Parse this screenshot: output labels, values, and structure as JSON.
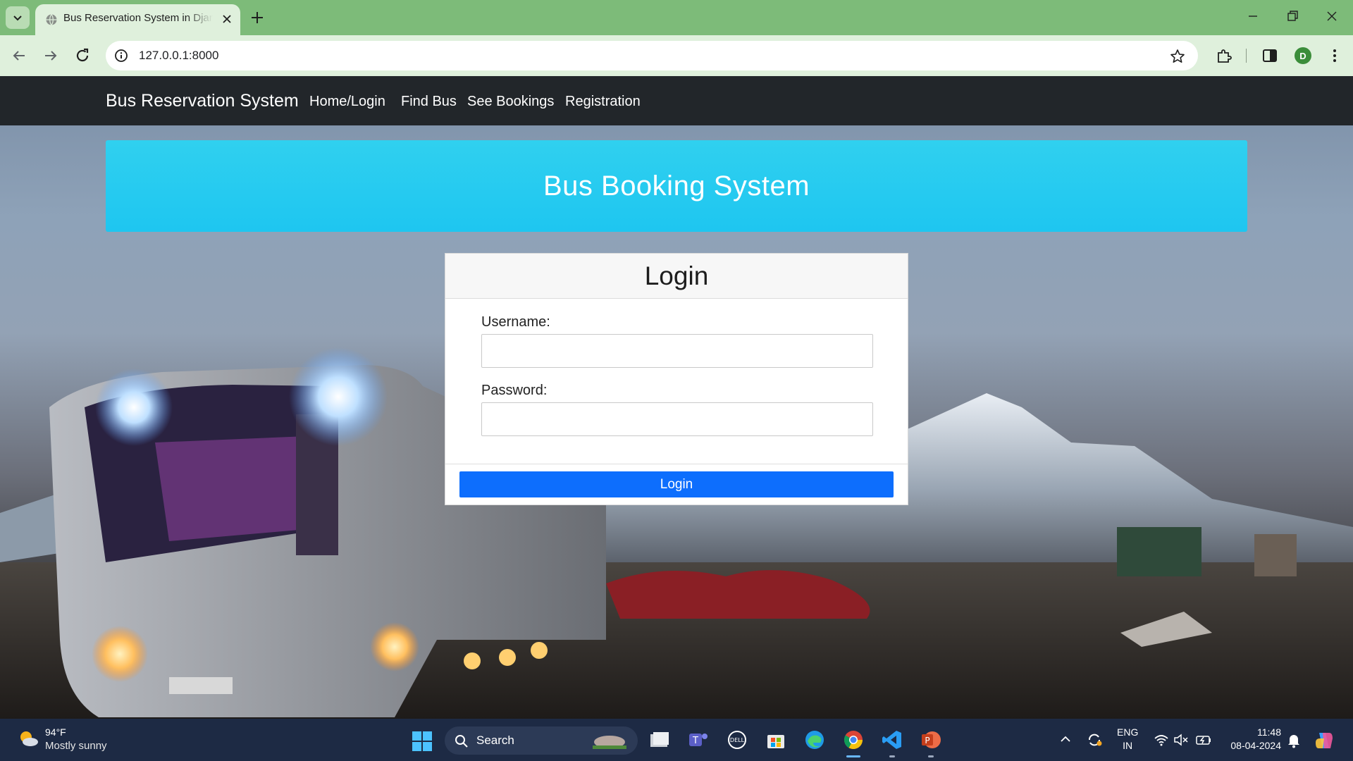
{
  "browser": {
    "tab_title": "Bus Reservation System in Django",
    "url": "127.0.0.1:8000",
    "profile_initial": "D"
  },
  "navbar": {
    "brand": "Bus Reservation System",
    "links": [
      "Home/Login",
      "Find Bus",
      "See Bookings",
      "Registration"
    ]
  },
  "jumbotron": {
    "title": "Bus Booking System"
  },
  "login_form": {
    "heading": "Login",
    "username_label": "Username:",
    "username_value": "",
    "password_label": "Password:",
    "password_value": "",
    "submit_label": "Login"
  },
  "taskbar": {
    "weather_temp": "94°F",
    "weather_condition": "Mostly sunny",
    "search_label": "Search",
    "language_line1": "ENG",
    "language_line2": "IN",
    "time": "11:48",
    "date": "08-04-2024"
  },
  "colors": {
    "tabstrip": "#7dbb79",
    "navbar": "#22262a",
    "jumbotron": "#1ec6f0",
    "primary_button": "#0d6efd",
    "taskbar": "#1d2a44"
  },
  "icons": [
    "chevron-down-icon",
    "globe-icon",
    "close-icon",
    "plus-icon",
    "minimize-icon",
    "restore-icon",
    "back-arrow-icon",
    "forward-arrow-icon",
    "reload-icon",
    "site-info-icon",
    "star-icon",
    "extensions-icon",
    "side-panel-icon",
    "more-vert-icon",
    "weather-icon",
    "windows-start-icon",
    "search-icon",
    "file-explorer-icon",
    "teams-icon",
    "dell-icon",
    "store-icon",
    "edge-icon",
    "chrome-icon",
    "vscode-icon",
    "powerpoint-icon",
    "chevron-up-icon",
    "sync-icon",
    "wifi-icon",
    "volume-muted-icon",
    "battery-icon",
    "notification-bell-icon",
    "copilot-icon"
  ]
}
